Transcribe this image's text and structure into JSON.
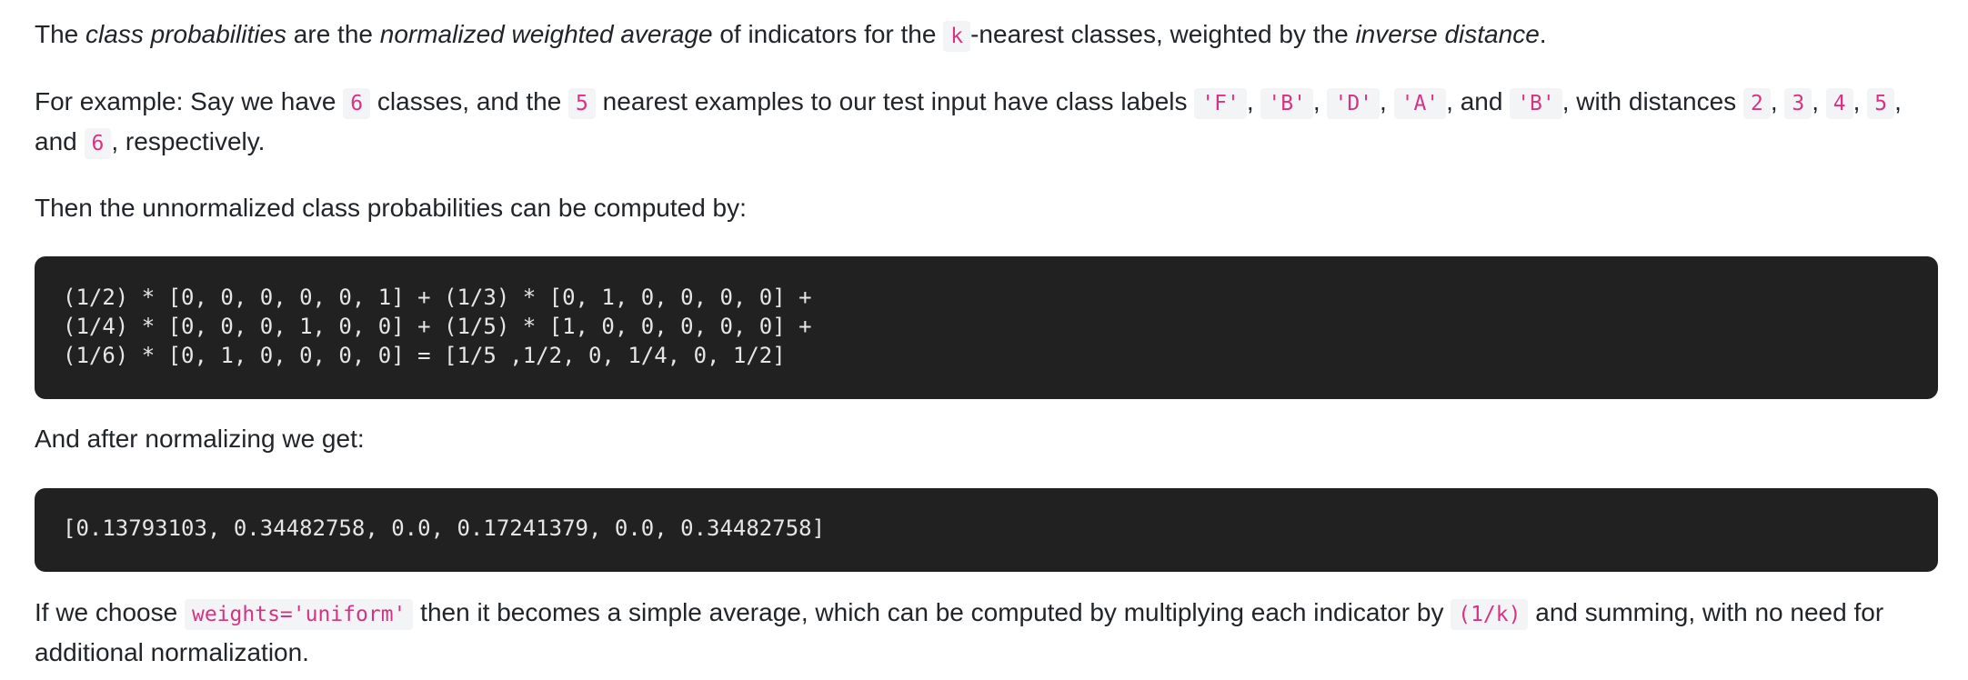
{
  "p1": {
    "t1": "The ",
    "em1": "class probabilities",
    "t2": " are the ",
    "em2": "normalized weighted average",
    "t3": " of indicators for the ",
    "code1": "k",
    "t4": "-nearest classes, weighted by the ",
    "em3": "inverse distance",
    "t5": "."
  },
  "p2": {
    "t1": "For example: Say we have ",
    "c_classes": "6",
    "t2": " classes, and the ",
    "c_nearest": "5",
    "t3": " nearest examples to our test input have class labels ",
    "c_F": "'F'",
    "c_B1": "'B'",
    "c_D": "'D'",
    "c_A": "'A'",
    "c_B2": "'B'",
    "t4": ", with distances ",
    "d2": "2",
    "d3": "3",
    "d4": "4",
    "d5": "5",
    "d6": "6",
    "comma": ", ",
    "and": ", and ",
    "t5": ", respectively."
  },
  "p3": {
    "text": "Then the unnormalized class probabilities can be computed by:"
  },
  "code1": {
    "line1": "(1/2) * [0, 0, 0, 0, 0, 1] + (1/3) * [0, 1, 0, 0, 0, 0] +",
    "line2": "(1/4) * [0, 0, 0, 1, 0, 0] + (1/5) * [1, 0, 0, 0, 0, 0] +",
    "line3": "(1/6) * [0, 1, 0, 0, 0, 0] = [1/5 ,1/2, 0, 1/4, 0, 1/2]"
  },
  "p4": {
    "text": "And after normalizing we get:"
  },
  "code2": {
    "line1": "[0.13793103, 0.34482758, 0.0, 0.17241379, 0.0, 0.34482758]"
  },
  "p5": {
    "t1": "If we choose ",
    "code1": "weights='uniform'",
    "t2": " then it becomes a simple average, which can be computed by multiplying each indicator by ",
    "code2": "(1/k)",
    "t3": " and summing, with no need for additional normalization."
  }
}
